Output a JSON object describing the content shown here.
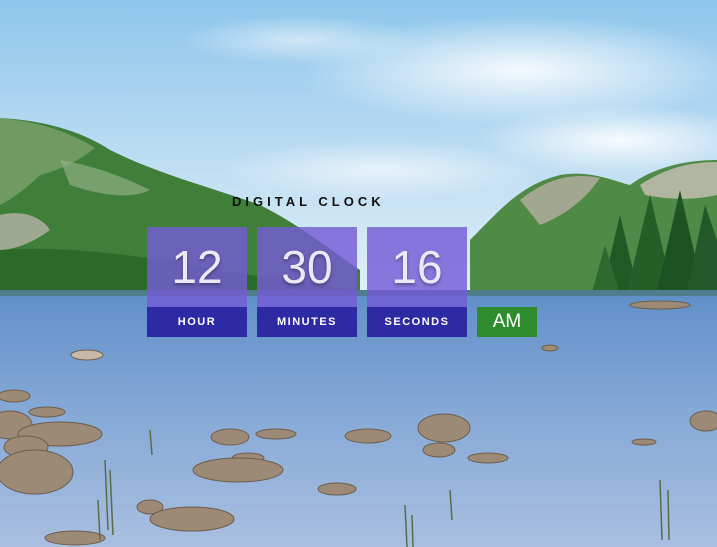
{
  "clock": {
    "title": "DIGITAL CLOCK",
    "hours": "12",
    "minutes": "30",
    "seconds": "16",
    "hours_label": "HOUR",
    "minutes_label": "MINUTES",
    "seconds_label": "SECONDS",
    "period": "AM"
  },
  "colors": {
    "tile_top": "#745cd6",
    "tile_bottom": "#2d2aa3",
    "ampm_bg": "#2e8b2e",
    "title_text": "#111111"
  }
}
